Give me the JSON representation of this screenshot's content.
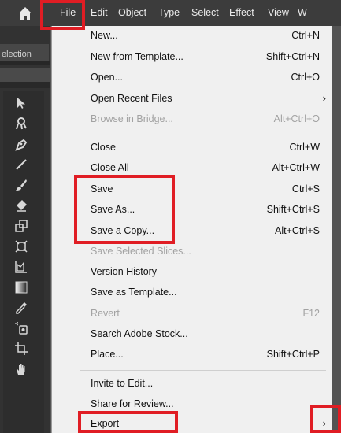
{
  "menubar": {
    "items": [
      "File",
      "Edit",
      "Object",
      "Type",
      "Select",
      "Effect",
      "View",
      "W"
    ],
    "home_icon": "home-icon"
  },
  "left_panel": {
    "selection_label": "election",
    "tools": [
      "direct-selection-icon",
      "puppet-warp-icon",
      "pen-icon",
      "line-icon",
      "paintbrush-icon",
      "eraser-icon",
      "scale-icon",
      "free-transform-icon",
      "graph-icon",
      "gradient-icon",
      "eyedropper-icon",
      "symbol-sprayer-icon",
      "artboard-icon",
      "hand-icon"
    ]
  },
  "file_menu": {
    "items": [
      {
        "label": "New...",
        "shortcut": "Ctrl+N"
      },
      {
        "label": "New from Template...",
        "shortcut": "Shift+Ctrl+N"
      },
      {
        "label": "Open...",
        "shortcut": "Ctrl+O"
      },
      {
        "label": "Open Recent Files",
        "shortcut": "",
        "submenu": true
      },
      {
        "label": "Browse in Bridge...",
        "shortcut": "Alt+Ctrl+O",
        "disabled": true
      },
      {
        "label": "Close",
        "shortcut": "Ctrl+W"
      },
      {
        "label": "Close All",
        "shortcut": "Alt+Ctrl+W"
      },
      {
        "label": "Save",
        "shortcut": "Ctrl+S"
      },
      {
        "label": "Save As...",
        "shortcut": "Shift+Ctrl+S"
      },
      {
        "label": "Save a Copy...",
        "shortcut": "Alt+Ctrl+S"
      },
      {
        "label": "Save Selected Slices...",
        "shortcut": "",
        "disabled": true
      },
      {
        "label": "Version History",
        "shortcut": ""
      },
      {
        "label": "Save as Template...",
        "shortcut": ""
      },
      {
        "label": "Revert",
        "shortcut": "F12",
        "disabled": true
      },
      {
        "label": "Search Adobe Stock...",
        "shortcut": ""
      },
      {
        "label": "Place...",
        "shortcut": "Shift+Ctrl+P"
      },
      {
        "label": "Invite to Edit...",
        "shortcut": ""
      },
      {
        "label": "Share for Review...",
        "shortcut": ""
      },
      {
        "label": "Export",
        "shortcut": "",
        "submenu": true
      }
    ],
    "submenu_arrow": "›"
  },
  "colors": {
    "highlight": "#e01d24",
    "menu_bg": "#f0f0f0",
    "menubar_bg": "#3c3c3c"
  }
}
